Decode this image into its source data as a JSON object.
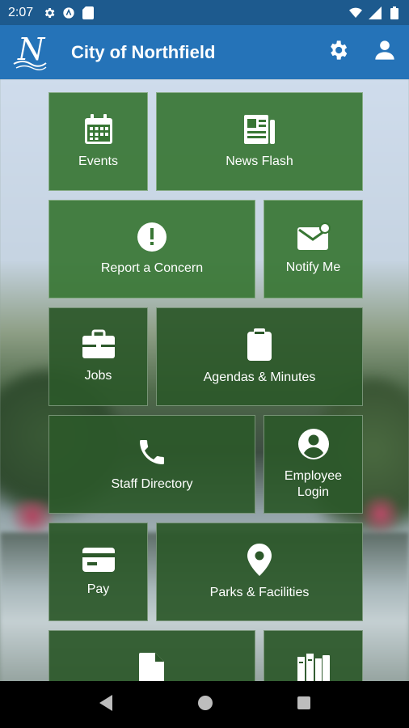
{
  "status_bar": {
    "time": "2:07"
  },
  "app_bar": {
    "logo_letter": "N",
    "title": "City of Northfield"
  },
  "tiles": [
    {
      "label": "Events",
      "icon": "calendar-icon"
    },
    {
      "label": "News Flash",
      "icon": "newspaper-icon"
    },
    {
      "label": "Report a Concern",
      "icon": "alert-icon"
    },
    {
      "label": "Notify Me",
      "icon": "mail-notification-icon"
    },
    {
      "label": "Jobs",
      "icon": "briefcase-icon"
    },
    {
      "label": "Agendas & Minutes",
      "icon": "clipboard-icon"
    },
    {
      "label": "Staff Directory",
      "icon": "phone-icon"
    },
    {
      "label": "Employee Login",
      "icon": "account-circle-icon"
    },
    {
      "label": "Pay",
      "icon": "credit-card-icon"
    },
    {
      "label": "Parks & Facilities",
      "icon": "location-pin-icon"
    },
    {
      "label": "",
      "icon": "document-icon"
    },
    {
      "label": "",
      "icon": "library-icon"
    }
  ],
  "colors": {
    "status_bar": "#1d5a8e",
    "app_bar": "#2573b8",
    "tile": "#387634"
  }
}
